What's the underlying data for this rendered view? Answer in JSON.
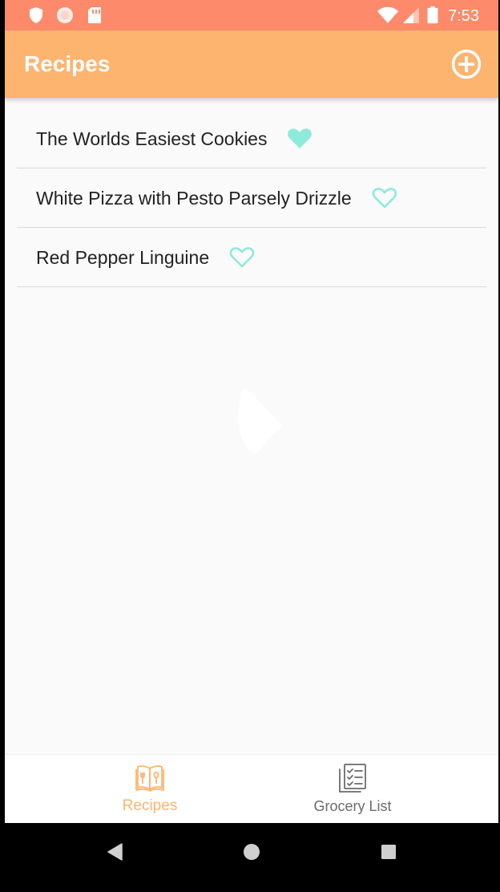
{
  "status_bar": {
    "time": "7:53",
    "icons": [
      "shield-icon",
      "circle-notification-icon",
      "sd-card-icon",
      "wifi-icon",
      "cell-signal-icon",
      "battery-icon"
    ],
    "background": "#fd8a6a"
  },
  "app_bar": {
    "title": "Recipes",
    "action_icon": "add-circle-icon",
    "background": "#fdb46f"
  },
  "recipes": [
    {
      "name": "The Worlds Easiest Cookies",
      "favorite": true
    },
    {
      "name": "White Pizza with Pesto Parsely Drizzle",
      "favorite": false
    },
    {
      "name": "Red Pepper Linguine",
      "favorite": false
    }
  ],
  "bottom_nav": {
    "tabs": [
      {
        "label": "Recipes",
        "icon": "recipe-book-icon",
        "active": true
      },
      {
        "label": "Grocery List",
        "icon": "checklist-icon",
        "active": false
      }
    ]
  },
  "system_nav": [
    "back-icon",
    "home-icon",
    "recents-icon"
  ],
  "colors": {
    "accent": "#fdb46f",
    "heart": "#8eeadb",
    "status": "#fd8a6a"
  }
}
